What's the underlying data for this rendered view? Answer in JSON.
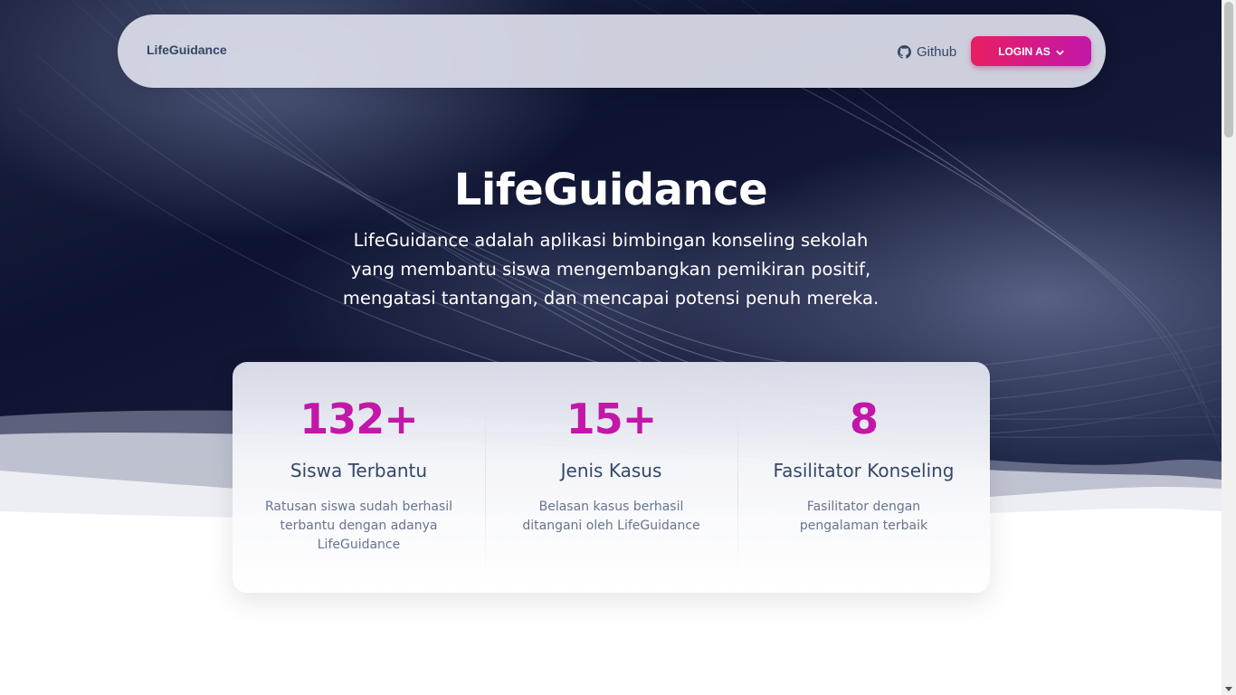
{
  "navbar": {
    "brand": "LifeGuidance",
    "github_label": "Github",
    "login_label": "LOGIN AS"
  },
  "hero": {
    "title": "LifeGuidance",
    "subtitle": "LifeGuidance adalah aplikasi bimbingan konseling sekolah yang membantu siswa mengembangkan pemikiran positif, mengatasi tantangan, dan mencapai potensi penuh mereka."
  },
  "stats": [
    {
      "number": "132+",
      "title": "Siswa Terbantu",
      "desc": "Ratusan siswa sudah berhasil terbantu dengan adanya LifeGuidance"
    },
    {
      "number": "15+",
      "title": "Jenis Kasus",
      "desc": "Belasan kasus berhasil ditangani oleh LifeGuidance"
    },
    {
      "number": "8",
      "title": "Fasilitator Konseling",
      "desc": "Fasilitator dengan pengalaman terbaik"
    }
  ],
  "colors": {
    "accent": "#c217a8",
    "button_start": "#e91e63",
    "text_dark": "#344767",
    "text_muted": "#67748e"
  },
  "icons": {
    "github": "github-icon",
    "dropdown": "chevron-down-icon"
  }
}
